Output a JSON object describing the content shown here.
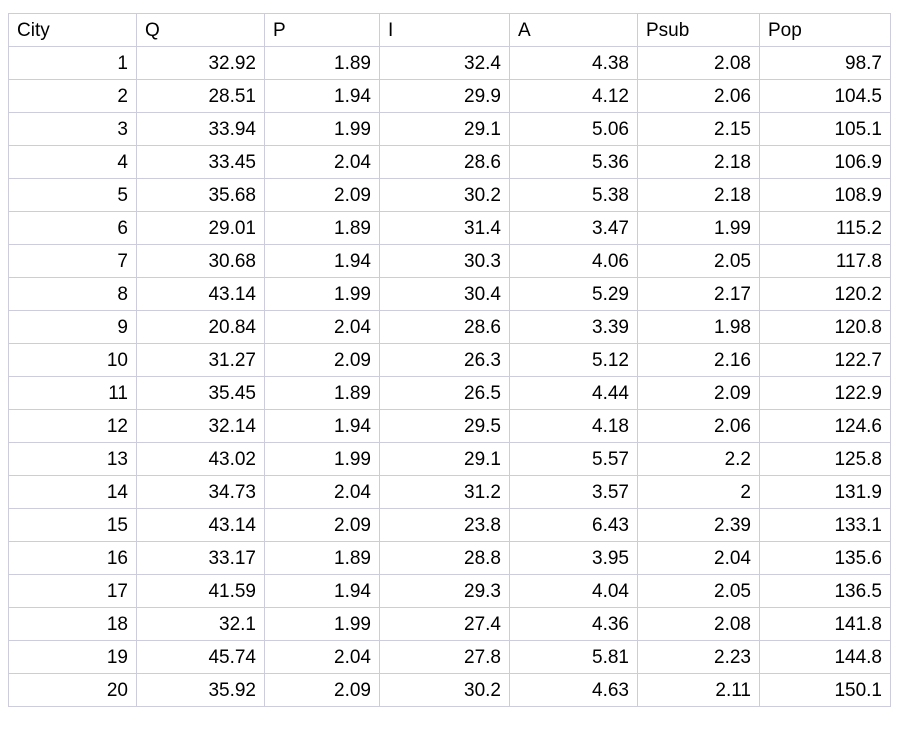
{
  "table": {
    "columns": [
      "City",
      "Q",
      "P",
      "I",
      "A",
      "Psub",
      "Pop"
    ],
    "rows": [
      [
        "1",
        "32.92",
        "1.89",
        "32.4",
        "4.38",
        "2.08",
        "98.7"
      ],
      [
        "2",
        "28.51",
        "1.94",
        "29.9",
        "4.12",
        "2.06",
        "104.5"
      ],
      [
        "3",
        "33.94",
        "1.99",
        "29.1",
        "5.06",
        "2.15",
        "105.1"
      ],
      [
        "4",
        "33.45",
        "2.04",
        "28.6",
        "5.36",
        "2.18",
        "106.9"
      ],
      [
        "5",
        "35.68",
        "2.09",
        "30.2",
        "5.38",
        "2.18",
        "108.9"
      ],
      [
        "6",
        "29.01",
        "1.89",
        "31.4",
        "3.47",
        "1.99",
        "115.2"
      ],
      [
        "7",
        "30.68",
        "1.94",
        "30.3",
        "4.06",
        "2.05",
        "117.8"
      ],
      [
        "8",
        "43.14",
        "1.99",
        "30.4",
        "5.29",
        "2.17",
        "120.2"
      ],
      [
        "9",
        "20.84",
        "2.04",
        "28.6",
        "3.39",
        "1.98",
        "120.8"
      ],
      [
        "10",
        "31.27",
        "2.09",
        "26.3",
        "5.12",
        "2.16",
        "122.7"
      ],
      [
        "11",
        "35.45",
        "1.89",
        "26.5",
        "4.44",
        "2.09",
        "122.9"
      ],
      [
        "12",
        "32.14",
        "1.94",
        "29.5",
        "4.18",
        "2.06",
        "124.6"
      ],
      [
        "13",
        "43.02",
        "1.99",
        "29.1",
        "5.57",
        "2.2",
        "125.8"
      ],
      [
        "14",
        "34.73",
        "2.04",
        "31.2",
        "3.57",
        "2",
        "131.9"
      ],
      [
        "15",
        "43.14",
        "2.09",
        "23.8",
        "6.43",
        "2.39",
        "133.1"
      ],
      [
        "16",
        "33.17",
        "1.89",
        "28.8",
        "3.95",
        "2.04",
        "135.6"
      ],
      [
        "17",
        "41.59",
        "1.94",
        "29.3",
        "4.04",
        "2.05",
        "136.5"
      ],
      [
        "18",
        "32.1",
        "1.99",
        "27.4",
        "4.36",
        "2.08",
        "141.8"
      ],
      [
        "19",
        "45.74",
        "2.04",
        "27.8",
        "5.81",
        "2.23",
        "144.8"
      ],
      [
        "20",
        "35.92",
        "2.09",
        "30.2",
        "4.63",
        "2.11",
        "150.1"
      ]
    ]
  },
  "chart_data": {
    "type": "table",
    "title": "",
    "columns": [
      "City",
      "Q",
      "P",
      "I",
      "A",
      "Psub",
      "Pop"
    ],
    "series": [
      {
        "name": "City",
        "values": [
          1,
          2,
          3,
          4,
          5,
          6,
          7,
          8,
          9,
          10,
          11,
          12,
          13,
          14,
          15,
          16,
          17,
          18,
          19,
          20
        ]
      },
      {
        "name": "Q",
        "values": [
          32.92,
          28.51,
          33.94,
          33.45,
          35.68,
          29.01,
          30.68,
          43.14,
          20.84,
          31.27,
          35.45,
          32.14,
          43.02,
          34.73,
          43.14,
          33.17,
          41.59,
          32.1,
          45.74,
          35.92
        ]
      },
      {
        "name": "P",
        "values": [
          1.89,
          1.94,
          1.99,
          2.04,
          2.09,
          1.89,
          1.94,
          1.99,
          2.04,
          2.09,
          1.89,
          1.94,
          1.99,
          2.04,
          2.09,
          1.89,
          1.94,
          1.99,
          2.04,
          2.09
        ]
      },
      {
        "name": "I",
        "values": [
          32.4,
          29.9,
          29.1,
          28.6,
          30.2,
          31.4,
          30.3,
          30.4,
          28.6,
          26.3,
          26.5,
          29.5,
          29.1,
          31.2,
          23.8,
          28.8,
          29.3,
          27.4,
          27.8,
          30.2
        ]
      },
      {
        "name": "A",
        "values": [
          4.38,
          4.12,
          5.06,
          5.36,
          5.38,
          3.47,
          4.06,
          5.29,
          3.39,
          5.12,
          4.44,
          4.18,
          5.57,
          3.57,
          6.43,
          3.95,
          4.04,
          4.36,
          5.81,
          4.63
        ]
      },
      {
        "name": "Psub",
        "values": [
          2.08,
          2.06,
          2.15,
          2.18,
          2.18,
          1.99,
          2.05,
          2.17,
          1.98,
          2.16,
          2.09,
          2.06,
          2.2,
          2,
          2.39,
          2.04,
          2.05,
          2.08,
          2.23,
          2.11
        ]
      },
      {
        "name": "Pop",
        "values": [
          98.7,
          104.5,
          105.1,
          106.9,
          108.9,
          115.2,
          117.8,
          120.2,
          120.8,
          122.7,
          122.9,
          124.6,
          125.8,
          131.9,
          133.1,
          135.6,
          136.5,
          141.8,
          144.8,
          150.1
        ]
      }
    ]
  },
  "style": {
    "border_color": "#ccccdd",
    "text_color": "#000000",
    "background": "#ffffff"
  }
}
